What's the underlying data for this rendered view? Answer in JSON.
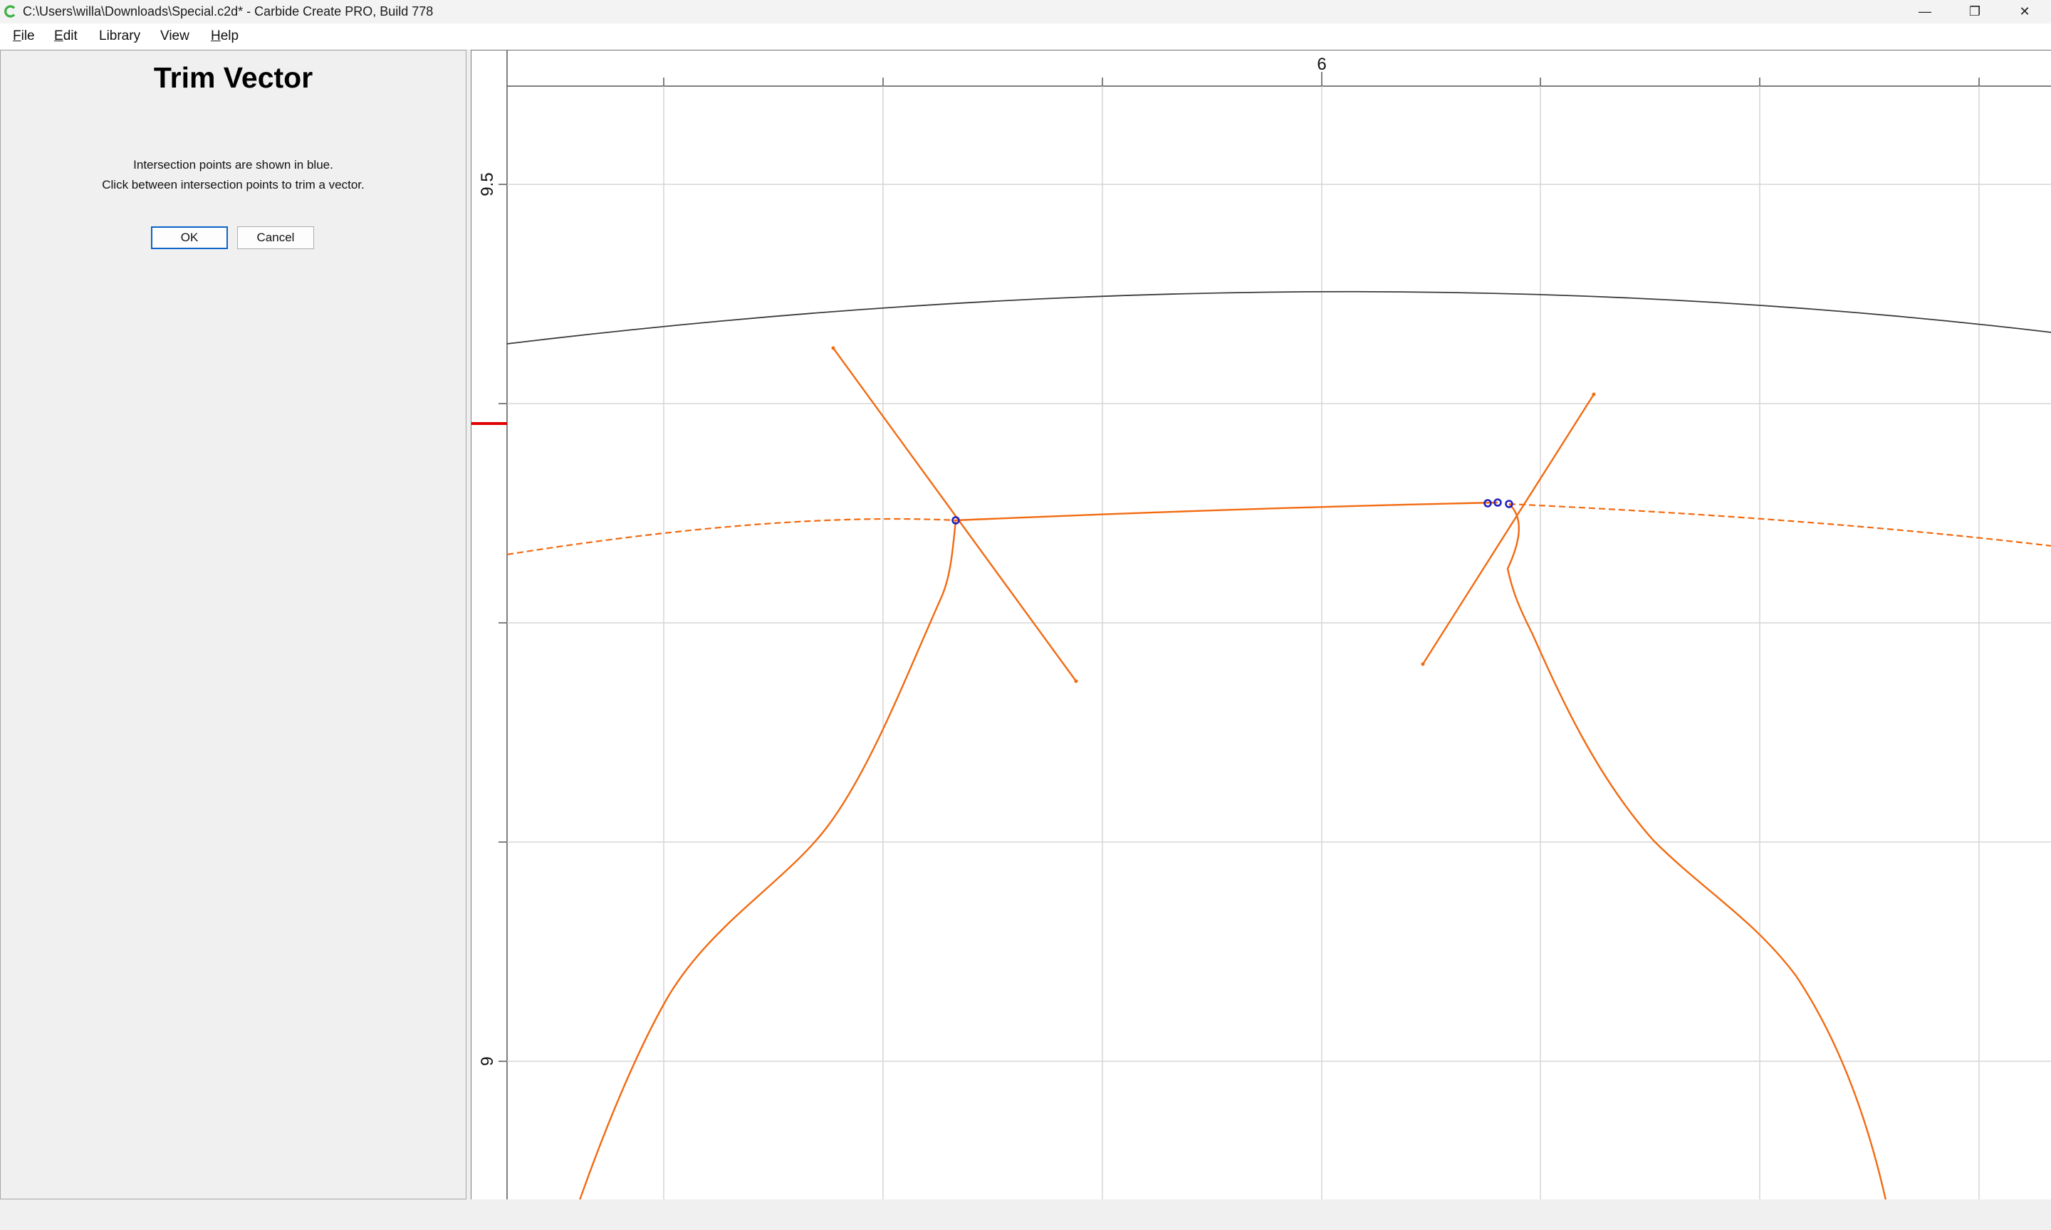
{
  "window": {
    "title": "C:\\Users\\willa\\Downloads\\Special.c2d* - Carbide Create PRO, Build 778",
    "app_icon": "carbide-c-icon",
    "minimize_glyph": "—",
    "maximize_glyph": "❐",
    "close_glyph": "✕"
  },
  "menu": {
    "items": [
      {
        "first": "F",
        "rest": "ile"
      },
      {
        "first": "E",
        "rest": "dit"
      },
      {
        "first": "",
        "rest": "Library"
      },
      {
        "first": "",
        "rest": "View"
      },
      {
        "first": "H",
        "rest": "elp"
      }
    ]
  },
  "panel": {
    "title": "Trim Vector",
    "line1": "Intersection points are shown in blue.",
    "line2": "Click between intersection points to trim a vector.",
    "ok_label": "OK",
    "cancel_label": "Cancel"
  },
  "canvas": {
    "ruler": {
      "x_label": "6",
      "y_label_top": "9.5",
      "y_label_bottom": "9"
    },
    "colors": {
      "vector": "#f26a10",
      "intersection": "#2020c0",
      "reference_arc": "#3a3a3a",
      "ruler_marker": "#e00000",
      "grid": "#d6d6d6"
    }
  }
}
